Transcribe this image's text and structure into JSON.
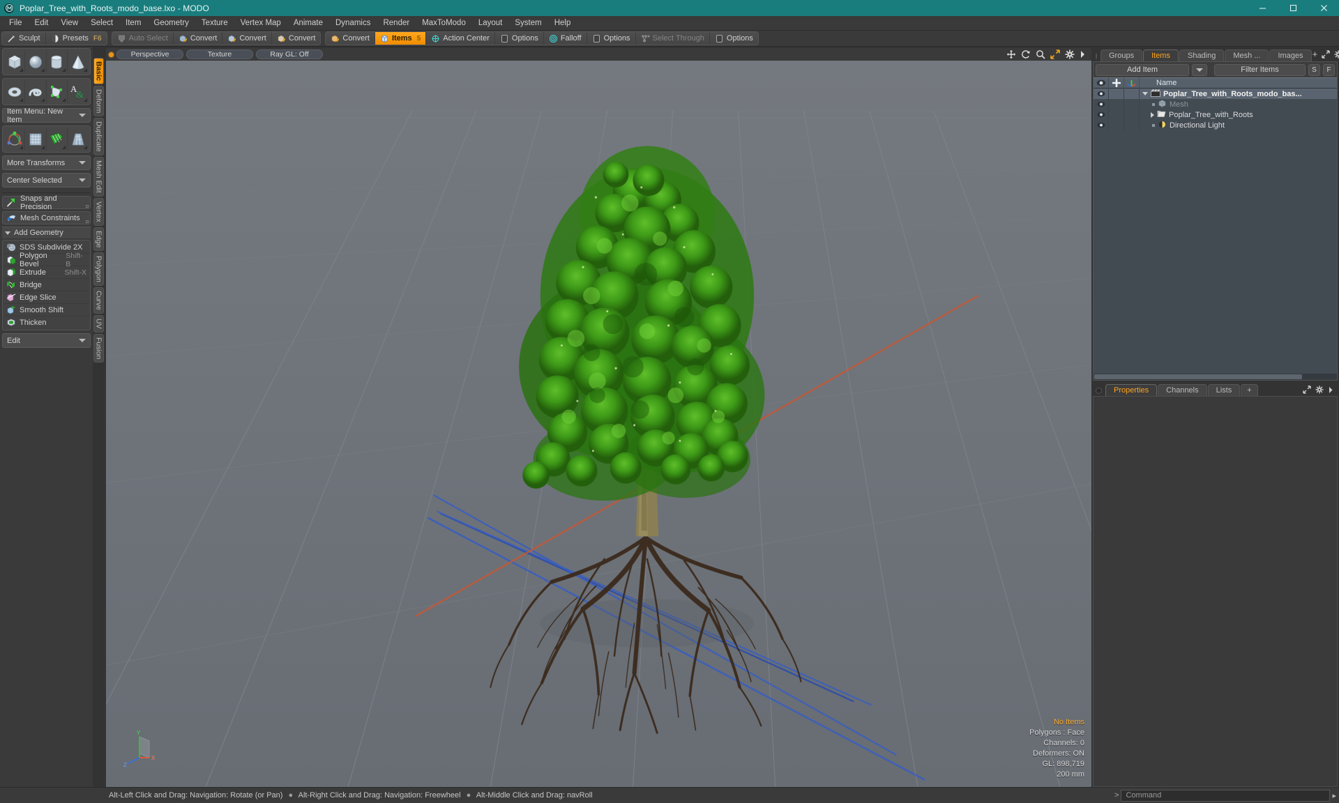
{
  "titlebar": {
    "logo": "modo-logo-icon",
    "title": "Poplar_Tree_with_Roots_modo_base.lxo - MODO",
    "minimize": "minimize-icon",
    "maximize": "maximize-icon",
    "close": "close-icon",
    "accent": "#1a7d7d"
  },
  "menubar": {
    "items": [
      "File",
      "Edit",
      "View",
      "Select",
      "Item",
      "Geometry",
      "Texture",
      "Vertex Map",
      "Animate",
      "Dynamics",
      "Render",
      "MaxToModo",
      "Layout",
      "System",
      "Help"
    ]
  },
  "toolbar": {
    "groups": [
      {
        "buttons": [
          {
            "label": "Sculpt",
            "icon": "sculpt-icon",
            "state": "normal",
            "hint": ""
          },
          {
            "label": "Presets",
            "icon": "presets-icon",
            "state": "normal",
            "hint": "F6"
          }
        ]
      },
      {
        "buttons": [
          {
            "label": "Auto Select",
            "icon": "auto-select-icon",
            "state": "dim",
            "hint": ""
          },
          {
            "label": "Convert",
            "icon": "convert-vertex-icon",
            "state": "normal",
            "hint": ""
          },
          {
            "label": "Convert",
            "icon": "convert-edge-icon",
            "state": "normal",
            "hint": ""
          },
          {
            "label": "Convert",
            "icon": "convert-polygon-icon",
            "state": "normal",
            "hint": ""
          }
        ]
      },
      {
        "buttons": [
          {
            "label": "Convert",
            "icon": "convert-item-icon",
            "state": "normal",
            "hint": ""
          },
          {
            "label": "Items",
            "icon": "items-icon",
            "state": "active",
            "hint": "5"
          },
          {
            "label": "Action Center",
            "icon": "action-center-icon",
            "state": "normal",
            "hint": ""
          },
          {
            "label": "Options",
            "icon": "options-icon",
            "state": "normal",
            "hint": ""
          },
          {
            "label": "Falloff",
            "icon": "falloff-icon",
            "state": "normal",
            "hint": ""
          },
          {
            "label": "Options",
            "icon": "options-icon",
            "state": "normal",
            "hint": ""
          },
          {
            "label": "Select Through",
            "icon": "select-through-icon",
            "state": "dim",
            "hint": ""
          },
          {
            "label": "Options",
            "icon": "options-icon",
            "state": "normal",
            "hint": ""
          }
        ]
      }
    ]
  },
  "left_panel": {
    "primitives_row1": [
      "cube-icon",
      "sphere-icon",
      "cylinder-icon",
      "cone-icon"
    ],
    "primitives_row2": [
      "torus-icon",
      "spiral-icon",
      "polygon-tool-icon",
      "text-tool-icon"
    ],
    "item_menu": "Item Menu: New Item",
    "transform_row": [
      "transform-gizmo-icon",
      "bend-icon",
      "shear-icon",
      "taper-icon"
    ],
    "more_transforms": "More Transforms",
    "center_selected": "Center Selected",
    "snaps": {
      "label": "Snaps and Precision",
      "icon": "snap-icon"
    },
    "mesh_constraints": {
      "label": "Mesh Constraints",
      "icon": "constraint-icon"
    },
    "add_geometry_header": "Add Geometry",
    "geometry_tools": [
      {
        "label": "SDS Subdivide 2X",
        "icon": "sds-subdivide-icon",
        "shortcut": ""
      },
      {
        "label": "Polygon Bevel",
        "icon": "polygon-bevel-icon",
        "shortcut": "Shift-B"
      },
      {
        "label": "Extrude",
        "icon": "extrude-icon",
        "shortcut": "Shift-X"
      },
      {
        "label": "Bridge",
        "icon": "bridge-icon",
        "shortcut": ""
      },
      {
        "label": "Edge Slice",
        "icon": "edge-slice-icon",
        "shortcut": ""
      },
      {
        "label": "Smooth Shift",
        "icon": "smooth-shift-icon",
        "shortcut": ""
      },
      {
        "label": "Thicken",
        "icon": "thicken-icon",
        "shortcut": ""
      }
    ],
    "edit_dropdown": "Edit",
    "vtabs": [
      "Basic",
      "Deform",
      "Duplicate",
      "Mesh Edit",
      "Vertex",
      "Edge",
      "Polygon",
      "Curve",
      "UV",
      "Fusion"
    ],
    "vtab_active": "Basic"
  },
  "viewport": {
    "header": {
      "view_mode": "Perspective",
      "shading_mode": "Texture",
      "raygl": "Ray GL: Off",
      "icons": [
        "move-view-icon",
        "rotate-view-icon",
        "zoom-view-icon",
        "fit-view-icon",
        "gear-icon",
        "chevron-right-icon"
      ]
    },
    "stats": {
      "selection": "No Items",
      "polygons": "Polygons : Face",
      "channels": "Channels: 0",
      "deformers": "Deformers: ON",
      "gl": "GL: 898,719",
      "scale": "200 mm"
    },
    "axis_labels": {
      "y": "Y",
      "x": "X",
      "z": "Z"
    },
    "colors": {
      "background": "#6f747a",
      "x_axis": "#c4543a",
      "z_axis": "#3f5fc0",
      "grid": "#7d828a"
    },
    "model": {
      "name": "Poplar Tree with Roots",
      "foliage_color": "#3a8a1e",
      "trunk_color": "#8a8050",
      "root_color": "#3b2a1c"
    }
  },
  "right_panel": {
    "tabs": [
      "Groups",
      "Items",
      "Shading",
      "Mesh ...",
      "Images"
    ],
    "active_tab": "Items",
    "tab_add": "+",
    "tab_icons": [
      "expand-icon",
      "gear-icon",
      "chevron-right-icon"
    ],
    "add_item": "Add Item",
    "filter_placeholder": "Filter Items",
    "btn_s": "S",
    "btn_f": "F",
    "columns": [
      "eye-icon",
      "plus-icon",
      "axis-icon",
      "Name"
    ],
    "items": [
      {
        "label": "Poplar_Tree_with_Roots_modo_bas...",
        "icon": "scene-icon",
        "level": 0,
        "expander": "down",
        "style": "bold",
        "selected": true
      },
      {
        "label": "Mesh",
        "icon": "mesh-icon",
        "level": 1,
        "expander": "none",
        "style": "dim",
        "selected": false
      },
      {
        "label": "Poplar_Tree_with_Roots",
        "icon": "mesh-layer-icon",
        "level": 1,
        "expander": "right",
        "style": "normal",
        "selected": false
      },
      {
        "label": "Directional Light",
        "icon": "light-icon",
        "level": 1,
        "expander": "none",
        "style": "normal",
        "selected": false
      }
    ],
    "properties_tabs": [
      "Properties",
      "Channels",
      "Lists"
    ],
    "properties_active": "Properties",
    "properties_add": "+"
  },
  "statusbar": {
    "hints": [
      "Alt-Left Click and Drag: Navigation: Rotate (or Pan)",
      "Alt-Right Click and Drag: Navigation: Freewheel",
      "Alt-Middle Click and Drag: navRoll"
    ],
    "command_prompt": ">",
    "command_placeholder": "Command",
    "command_arrow": "▸"
  }
}
